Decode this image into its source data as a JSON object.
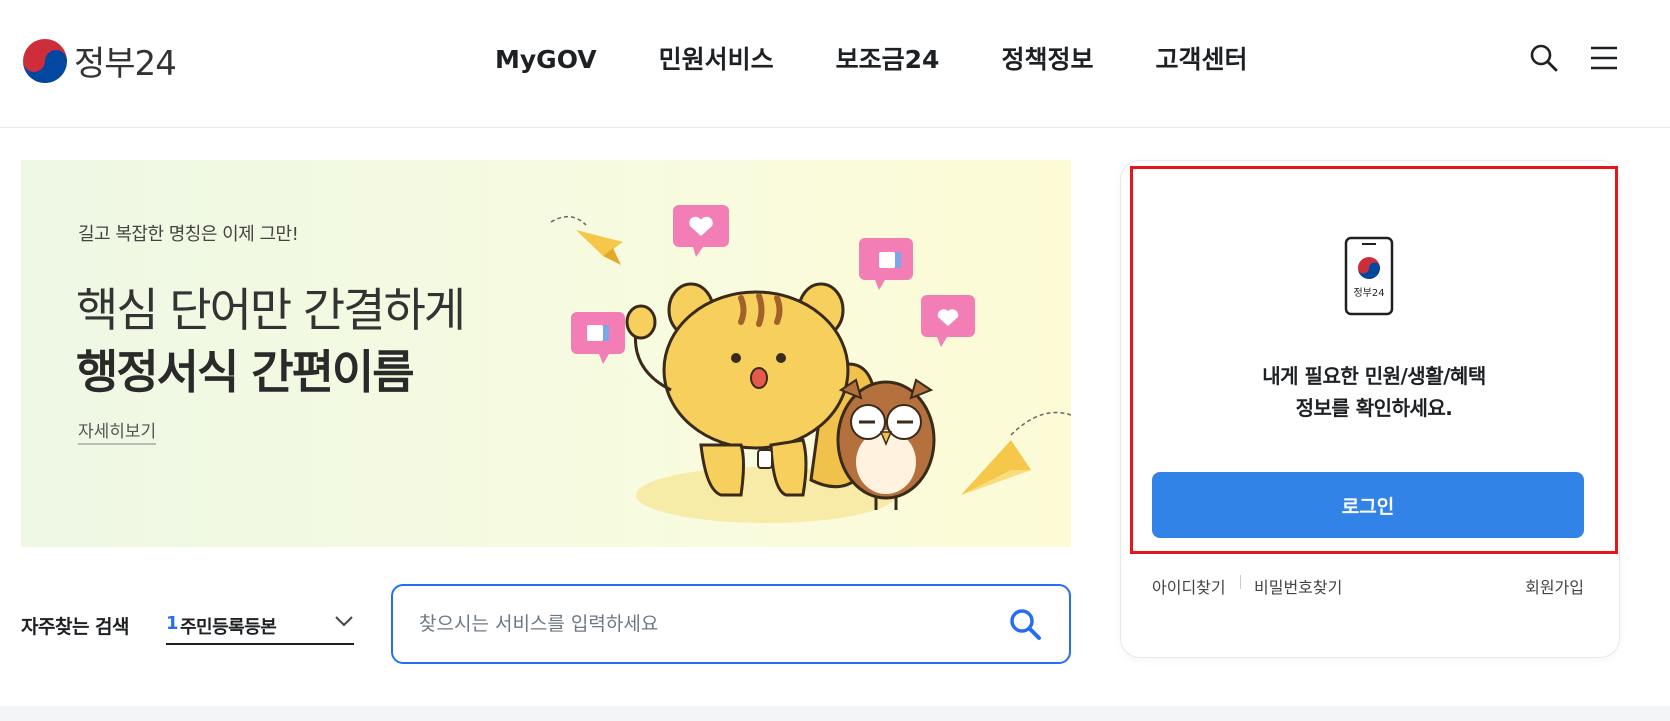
{
  "header": {
    "logo_text": "정부24",
    "nav": [
      "MyGOV",
      "민원서비스",
      "보조금24",
      "정책정보",
      "고객센터"
    ],
    "icons": [
      "search-icon",
      "hamburger-menu-icon"
    ]
  },
  "banner": {
    "eyebrow": "길고 복잡한 명칭은 이제 그만!",
    "line1": "핵심 단어만 간결하게",
    "line2": "행정서식 간편이름",
    "link": "자세히보기"
  },
  "search": {
    "frequent_label": "자주찾는 검색",
    "frequent_rank": "1",
    "frequent_item": "주민등록등본",
    "placeholder": "찾으시는 서비스를 입력하세요"
  },
  "login": {
    "phone_label": "정부24",
    "message_line1": "내게 필요한 민원/생활/혜택",
    "message_line2": "정보를 확인하세요.",
    "button": "로그인",
    "find_id": "아이디찾기",
    "find_pw": "비밀번호찾기",
    "join": "회원가입"
  },
  "colors": {
    "accent": "#256ef4",
    "login_button": "#3283e8",
    "highlight": "#e3161e",
    "pink": "#f27eb5"
  }
}
